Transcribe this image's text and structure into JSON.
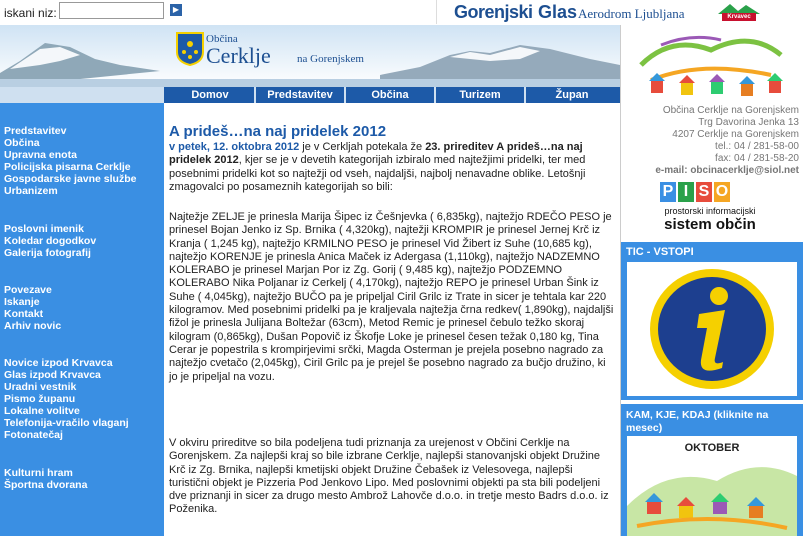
{
  "search": {
    "label": "iskani niz:",
    "value": "",
    "go_icon": "arrow-right-icon"
  },
  "ads": {
    "gorenjski": "Gorenjski",
    "glas": "Glas",
    "aerodrom": "Aerodrom Ljubljana",
    "krvavec": "Krvavec"
  },
  "header": {
    "obcina_small": "Občina",
    "name": "Cerklje",
    "na_gor": "na Gorenjskem"
  },
  "nav": [
    "Domov",
    "Predstavitev",
    "Občina",
    "Turizem",
    "Župan"
  ],
  "left_links": [
    "Predstavitev",
    "Občina",
    "Upravna enota",
    "Policijska pisarna Cerklje",
    "Gospodarske javne službe",
    "Urbanizem",
    "Poslovni imenik",
    "Koledar dogodkov",
    "Galerija fotografij",
    "Povezave",
    "Iskanje",
    "Kontakt",
    "Arhiv novic",
    "Novice izpod Krvavca",
    "Glas izpod Krvavca",
    "Uradni vestnik",
    "Pismo županu",
    "Lokalne volitve",
    "Telefonija-vračilo vlaganj",
    "Fotonatečaj",
    "Kulturni hram",
    "Športna dvorana"
  ],
  "article": {
    "title": "A prideš…na naj pridelek 2012",
    "date": "v petek, 12. oktobra 2012",
    "intro_1": " je v Cerkljah potekala že ",
    "intro_bold": "23. prireditev A prideš…na naj pridelek 2012",
    "intro_2": ", kjer se je v devetih kategorijah izbiralo med najtežjimi pridelki, ter med posebnimi pridelki kot so najtežji od vseh, najdaljši, najbolj nenavadne oblike. Letošnji zmagovalci po posameznih kategorijah so bili:",
    "body": "Najtežje ZELJE je prinesla Marija Šipec iz Češnjevka ( 6,835kg), najtežjo RDEČO PESO je prinesel Bojan Jenko iz Sp. Brnika ( 4,320kg), najtežji KROMPIR je prinesel Jernej Krč iz Kranja ( 1,245 kg), najtežjo KRMILNO PESO je prinesel Vid Žibert iz Suhe (10,685 kg), najtežjo KORENJE je prinesla Anica Maček iz Adergasa (1,110kg), najtežjo NADZEMNO KOLERABO je prinesel Marjan Por iz Zg. Gorij ( 9,485 kg), najtežjo PODZEMNO KOLERABO Nika Poljanar iz Cerkelj ( 4,170kg), najtežjo REPO je prinesel Urban Šink iz Suhe ( 4,045kg), najtežjo BUČO pa je pripeljal Ciril Grilc iz Trate in sicer je tehtala kar 220 kilogramov. Med posebnimi pridelki pa je kraljevala najtežja črna redkev( 1,890kg), najdaljši fižol je prinesla Julijana Boltežar (63cm), Metod Remic je prinesel čebulo težko skoraj kilogram (0,865kg), Dušan Popovič iz Škofje Loke je prinesel česen težak 0,180 kg, Tina Cerar je popestrila s krompirjevimi srčki, Magda Osterman je prejela posebno nagrado za najtežjo cvetačo (2,045kg), Ciril Grilc pa je prejel še posebno nagrado za bučjo družino, ki jo je pripeljal  na vozu.",
    "p2": "V okviru prireditve so bila podeljena tudi priznanja za urejenost v Občini Cerklje na Gorenjskem.  Za najlepši kraj so bile izbrane Cerklje, najlepši stanovanjski objekt Družine Krč iz Zg. Brnika, najlepši kmetijski objekt Družine Čebašek iz Velesovega, najlepši turistični objekt je Pizzeria Pod Jenkovo Lipo. Med poslovnimi objekti pa sta bili podeljeni dve priznanji in sicer za drugo mesto Ambrož Lahovče d.o.o. in tretje mesto Badrs d.o.o. iz Poženika."
  },
  "address": {
    "name": "Občina Cerklje na Gorenjskem",
    "street": "Trg Davorina Jenka 13",
    "city": "4207 Cerklje na Gorenjskem",
    "tel": "tel.: 04 / 281-58-00",
    "fax": "fax: 04 / 281-58-20",
    "email": "e-mail: obcinacerklje@siol.net"
  },
  "piso": {
    "letters": [
      "P",
      "I",
      "S",
      "O"
    ],
    "sub": "prostorski informacijski",
    "main": "sistem občin"
  },
  "tic": {
    "title": "TIC - VSTOPI",
    "icon": "info-icon"
  },
  "kam": {
    "title": "KAM, KJE, KDAJ (kliknite na mesec)",
    "month": "OKTOBER"
  },
  "colors": {
    "accent": "#1d5aa8",
    "sidebar": "#3a8fe3",
    "yellow": "#f5d000"
  }
}
